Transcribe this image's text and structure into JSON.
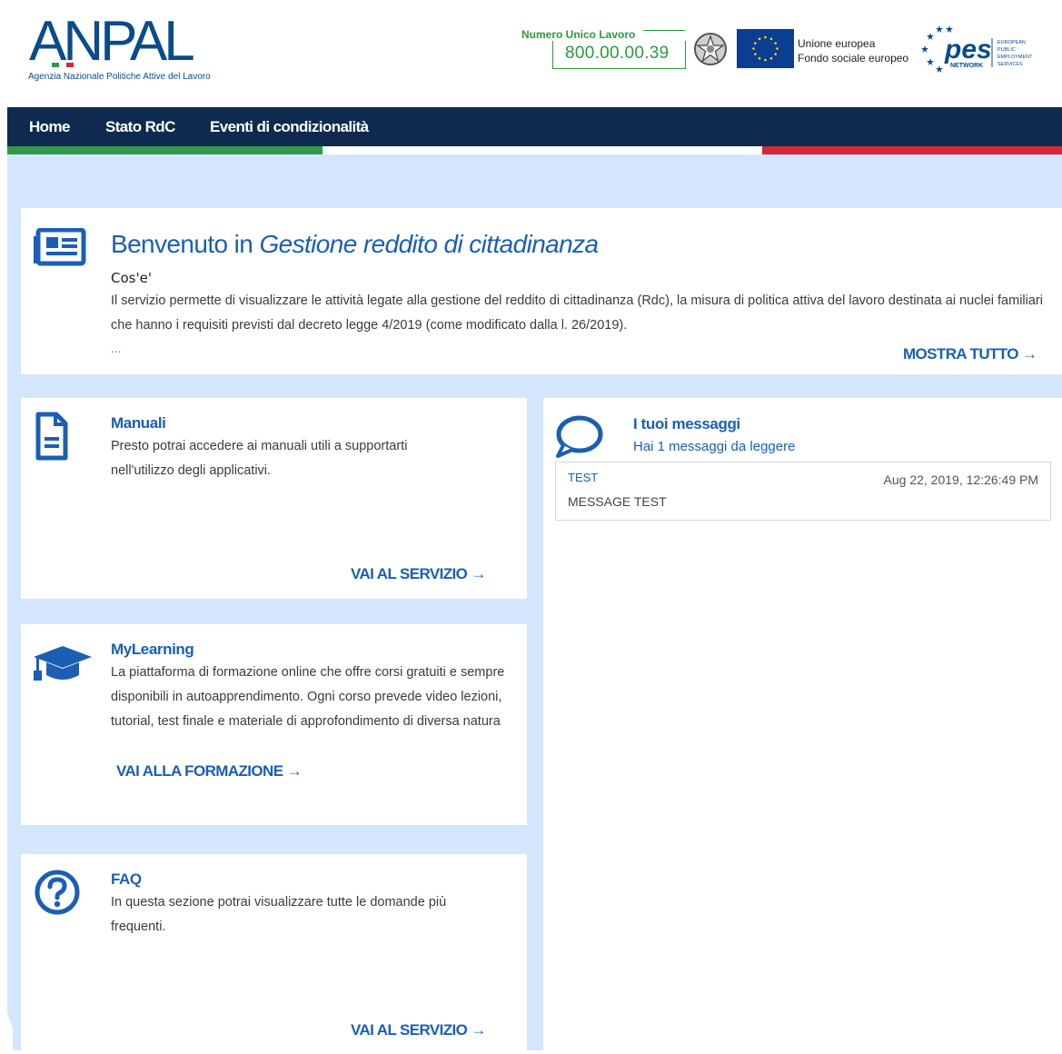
{
  "header": {
    "logo_text": "ANPAL",
    "logo_subtitle": "Agenzia Nazionale Politiche Attive del Lavoro",
    "numero_label": "Numero Unico Lavoro",
    "numero_value": "800.00.00.39",
    "eu_line1": "Unione europea",
    "eu_line2": "Fondo sociale europeo",
    "pes_logo_text": "pes",
    "pes_network": "NETWORK",
    "pes_side": [
      "EUROPEAN",
      "PUBLIC",
      "EMPLOYMENT",
      "SERVICES"
    ]
  },
  "nav": {
    "items": [
      {
        "label": "Home"
      },
      {
        "label": "Stato RdC"
      },
      {
        "label": "Eventi di condizionalità"
      }
    ]
  },
  "welcome": {
    "title_prefix": "Benvenuto in ",
    "title_italic": "Gestione reddito di cittadinanza",
    "subtitle": "Cos'e'",
    "text": "Il servizio permette di visualizzare le attività legate alla gestione del reddito di cittadinanza (Rdc), la misura di politica attiva del lavoro destinata ai nuclei familiari che hanno i requisiti previsti dal decreto legge 4/2019 (come modificato dalla l. 26/2019).",
    "ellipsis": "...",
    "link": "MOSTRA TUTTO →"
  },
  "manuali": {
    "title": "Manuali",
    "text": "Presto potrai accedere ai manuali utili a supportarti nell'utilizzo degli applicativi.",
    "link": "VAI AL SERVIZIO →"
  },
  "mylearning": {
    "title": "MyLearning",
    "text": "La piattaforma di formazione online che offre corsi gratuiti e sempre disponibili in autoapprendimento. Ogni corso prevede video lezioni, tutorial, test finale e materiale di approfondimento di diversa natura",
    "link": "VAI ALLA FORMAZIONE →"
  },
  "faq": {
    "title": "FAQ",
    "text": "In questa sezione potrai visualizzare tutte le domande più frequenti.",
    "link": "VAI AL SERVIZIO →"
  },
  "messages": {
    "title": "I tuoi messaggi",
    "subtitle": "Hai 1 messaggi da leggere",
    "items": [
      {
        "subject": "TEST",
        "date": "Aug 22, 2019, 12:26:49 PM",
        "body": "MESSAGE TEST"
      }
    ]
  },
  "colors": {
    "nav_bg": "#0f2a4f",
    "accent_blue": "#1a5fb4",
    "page_bg": "#d4e6fb",
    "green": "#2e9a47",
    "red": "#d3273a"
  }
}
